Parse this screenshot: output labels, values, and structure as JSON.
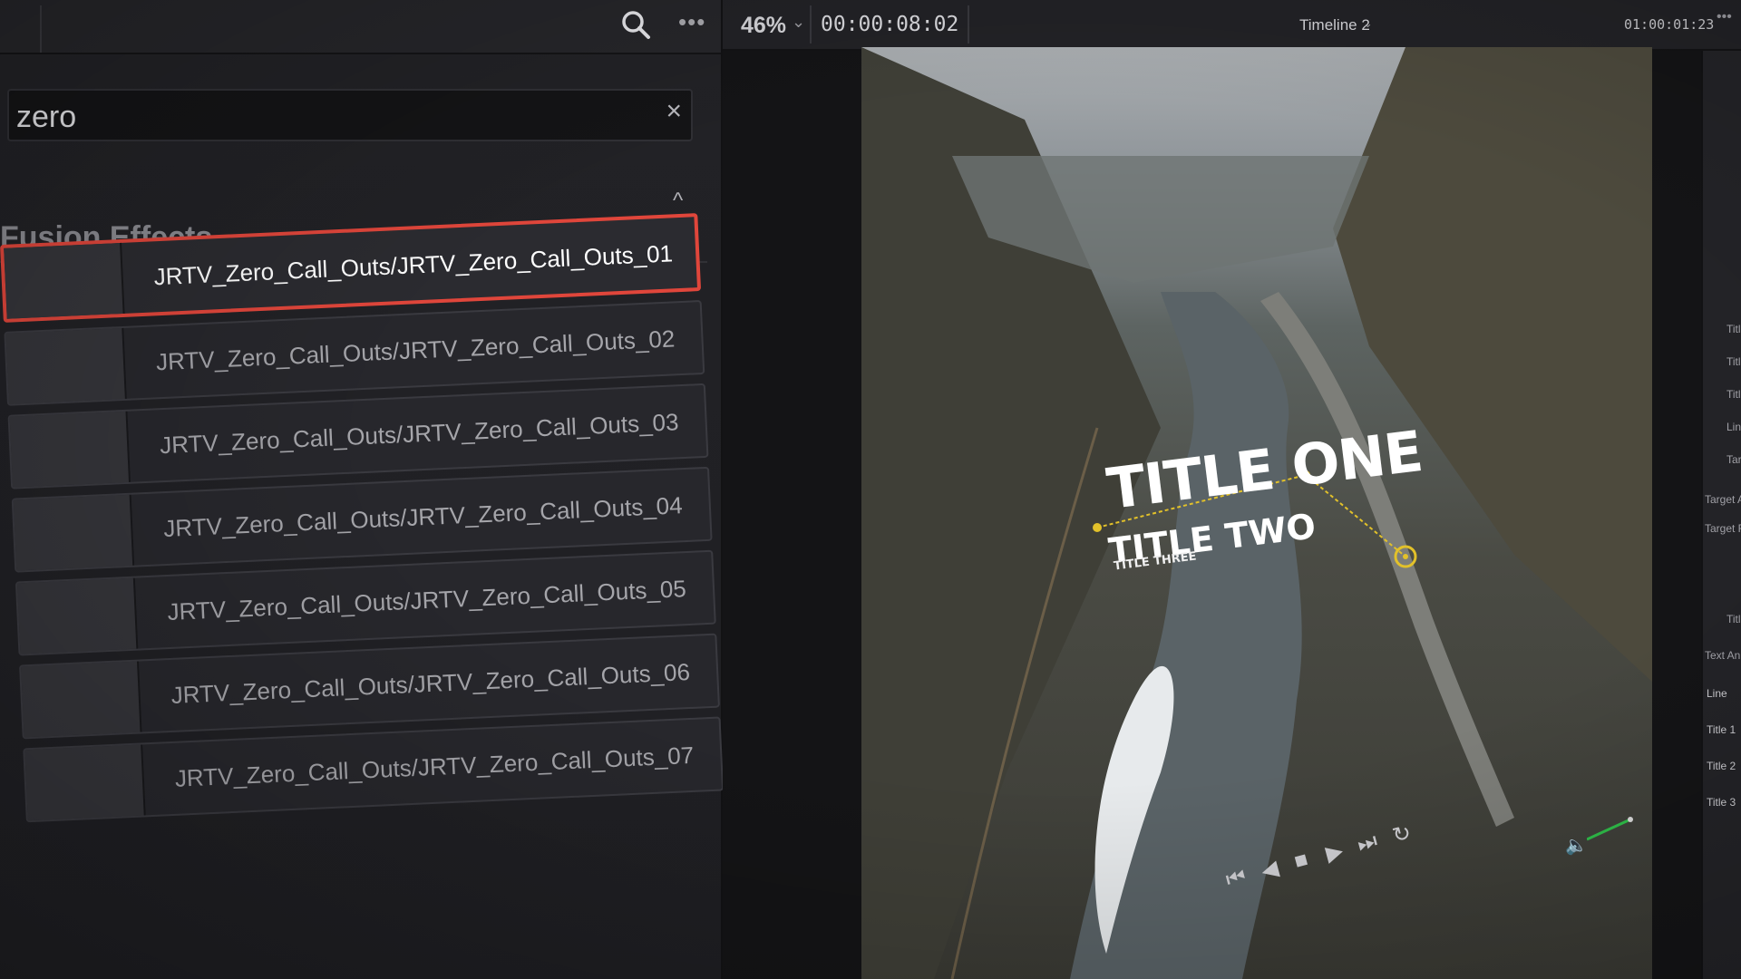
{
  "left_panel": {
    "search": {
      "value": "zero",
      "clear_icon": "close-icon"
    },
    "section_title": "Fusion Effects",
    "effects": [
      "JRTV_Zero_Call_Outs/JRTV_Zero_Call_Outs_01",
      "JRTV_Zero_Call_Outs/JRTV_Zero_Call_Outs_02",
      "JRTV_Zero_Call_Outs/JRTV_Zero_Call_Outs_03",
      "JRTV_Zero_Call_Outs/JRTV_Zero_Call_Outs_04",
      "JRTV_Zero_Call_Outs/JRTV_Zero_Call_Outs_05",
      "JRTV_Zero_Call_Outs/JRTV_Zero_Call_Outs_06",
      "JRTV_Zero_Call_Outs/JRTV_Zero_Call_Outs_07"
    ],
    "selected_index": 0,
    "colors": {
      "selection": "#e0463b"
    }
  },
  "toolbar": {
    "more": "•••"
  },
  "viewer": {
    "zoom": "46%",
    "timecode": "00:00:08:02",
    "timeline_name": "Timeline 2",
    "timeline_timecode": "01:00:01:23",
    "overlay": {
      "title_one": "TITLE ONE",
      "title_two": "TITLE TWO",
      "title_three": "TITLE THREE"
    },
    "colors": {
      "callout": "#e2c12a"
    }
  },
  "inspector": {
    "items": [
      "Title",
      "Title",
      "Title",
      "Line",
      "Targ",
      "Target Anim",
      "Target Ring",
      "Title",
      "Text Animati"
    ],
    "sections": [
      "Line",
      "Title 1",
      "Title 2",
      "Title 3"
    ]
  }
}
